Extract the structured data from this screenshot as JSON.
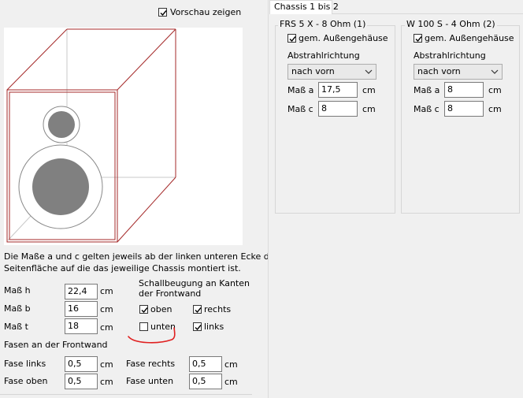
{
  "left": {
    "preview_checkbox": {
      "label": "Vorschau zeigen",
      "checked": true
    },
    "info_text_line1": "Die Maße a und c gelten jeweils ab der linken unteren Ecke der",
    "info_text_line2": "Seitenfläche auf die das jeweilige Chassis montiert ist.",
    "dimensions": [
      {
        "label": "Maß h",
        "value": "22,4",
        "unit": "cm"
      },
      {
        "label": "Maß b",
        "value": "16",
        "unit": "cm"
      },
      {
        "label": "Maß t",
        "value": "18",
        "unit": "cm"
      }
    ],
    "diffraction": {
      "title_line1": "Schallbeugung an Kanten",
      "title_line2": "der Frontwand",
      "oben": {
        "label": "oben",
        "checked": true
      },
      "rechts": {
        "label": "rechts",
        "checked": true
      },
      "unten": {
        "label": "unten",
        "checked": false
      },
      "links": {
        "label": "links",
        "checked": true
      }
    },
    "bevel": {
      "title": "Fasen an der Frontwand",
      "fase_links": {
        "label": "Fase links",
        "value": "0,5",
        "unit": "cm"
      },
      "fase_rechts": {
        "label": "Fase rechts",
        "value": "0,5",
        "unit": "cm"
      },
      "fase_oben": {
        "label": "Fase oben",
        "value": "0,5",
        "unit": "cm"
      },
      "fase_unten": {
        "label": "Fase unten",
        "value": "0,5",
        "unit": "cm"
      }
    }
  },
  "right": {
    "tab_label": "Chassis 1 bis 2",
    "chassis": [
      {
        "title": "FRS 5 X - 8 Ohm (1)",
        "same_housing": {
          "label": "gem. Außengehäuse",
          "checked": true
        },
        "direction_label": "Abstrahlrichtung",
        "direction_value": "nach vorn",
        "mass_a": {
          "label": "Maß a",
          "value": "17,5",
          "unit": "cm"
        },
        "mass_c": {
          "label": "Maß c",
          "value": "8",
          "unit": "cm"
        }
      },
      {
        "title": "W 100 S - 4 Ohm (2)",
        "same_housing": {
          "label": "gem. Außengehäuse",
          "checked": true
        },
        "direction_label": "Abstrahlrichtung",
        "direction_value": "nach vorn",
        "mass_a": {
          "label": "Maß a",
          "value": "8",
          "unit": "cm"
        },
        "mass_c": {
          "label": "Maß c",
          "value": "8",
          "unit": "cm"
        }
      }
    ]
  },
  "colors": {
    "cabinet_outline": "#a52a2a",
    "driver_fill": "#808080",
    "annotation": "#e02020"
  }
}
